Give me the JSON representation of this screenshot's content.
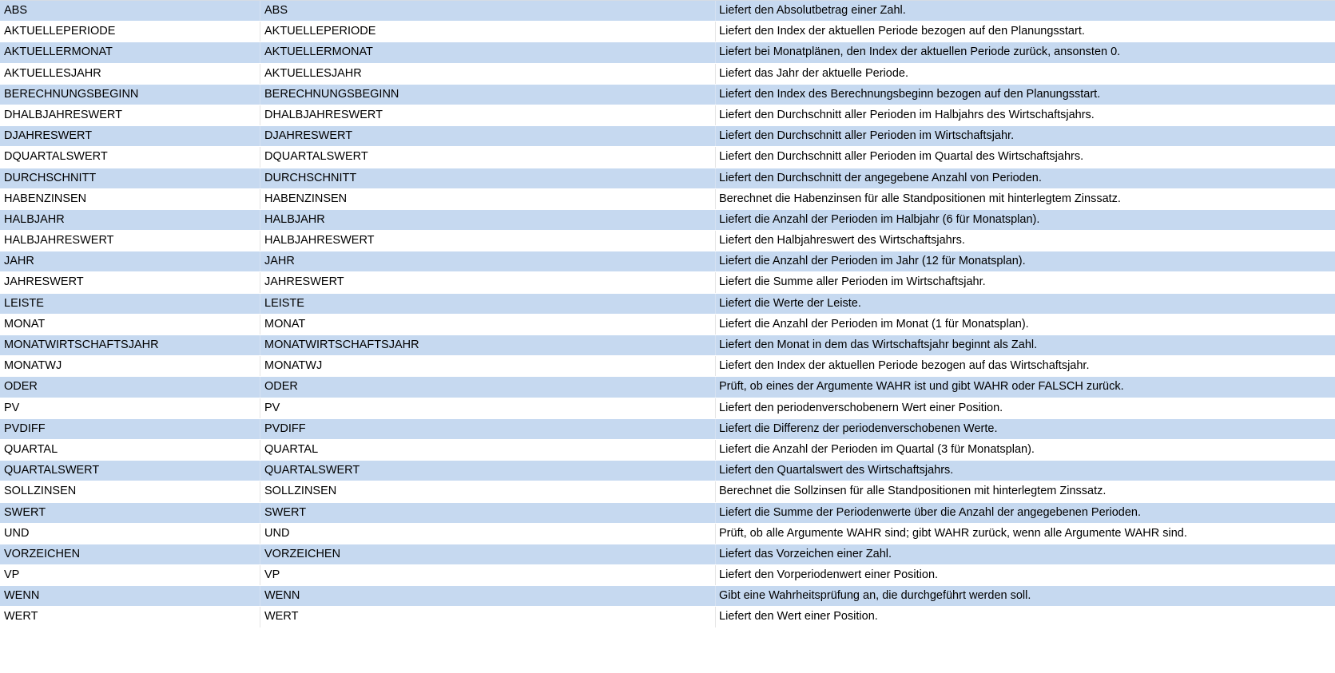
{
  "colors": {
    "band": "#c6d9f0",
    "plain": "#ffffff",
    "text": "#000000"
  },
  "rows": [
    {
      "name": "ABS",
      "code": "ABS",
      "description": "Liefert den Absolutbetrag einer Zahl."
    },
    {
      "name": "AKTUELLEPERIODE",
      "code": "AKTUELLEPERIODE",
      "description": "Liefert den Index der aktuellen Periode bezogen auf den Planungsstart."
    },
    {
      "name": "AKTUELLERMONAT",
      "code": "AKTUELLERMONAT",
      "description": "Liefert bei Monatplänen, den Index der aktuellen Periode zurück, ansonsten 0."
    },
    {
      "name": "AKTUELLESJAHR",
      "code": "AKTUELLESJAHR",
      "description": "Liefert das Jahr der aktuelle Periode."
    },
    {
      "name": "BERECHNUNGSBEGINN",
      "code": "BERECHNUNGSBEGINN",
      "description": "Liefert den Index des Berechnungsbeginn bezogen auf den Planungsstart."
    },
    {
      "name": "DHALBJAHRESWERT",
      "code": "DHALBJAHRESWERT",
      "description": "Liefert den Durchschnitt aller Perioden im Halbjahrs des Wirtschaftsjahrs."
    },
    {
      "name": "DJAHRESWERT",
      "code": "DJAHRESWERT",
      "description": "Liefert den Durchschnitt aller Perioden im Wirtschaftsjahr."
    },
    {
      "name": "DQUARTALSWERT",
      "code": "DQUARTALSWERT",
      "description": "Liefert den Durchschnitt aller Perioden im Quartal des Wirtschaftsjahrs."
    },
    {
      "name": "DURCHSCHNITT",
      "code": "DURCHSCHNITT",
      "description": "Liefert den Durchschnitt der angegebene Anzahl von Perioden."
    },
    {
      "name": "HABENZINSEN",
      "code": "HABENZINSEN",
      "description": "Berechnet die Habenzinsen für alle Standpositionen mit hinterlegtem Zinssatz."
    },
    {
      "name": "HALBJAHR",
      "code": "HALBJAHR",
      "description": "Liefert die Anzahl der Perioden im Halbjahr (6 für Monatsplan)."
    },
    {
      "name": "HALBJAHRESWERT",
      "code": "HALBJAHRESWERT",
      "description": "Liefert den Halbjahreswert des Wirtschaftsjahrs."
    },
    {
      "name": "JAHR",
      "code": "JAHR",
      "description": "Liefert die Anzahl der Perioden im Jahr (12 für Monatsplan)."
    },
    {
      "name": "JAHRESWERT",
      "code": "JAHRESWERT",
      "description": "Liefert die Summe aller Perioden im Wirtschaftsjahr."
    },
    {
      "name": "LEISTE",
      "code": "LEISTE",
      "description": "Liefert die Werte der Leiste."
    },
    {
      "name": "MONAT",
      "code": "MONAT",
      "description": "Liefert die Anzahl der Perioden im Monat (1 für Monatsplan)."
    },
    {
      "name": "MONATWIRTSCHAFTSJAHR",
      "code": "MONATWIRTSCHAFTSJAHR",
      "description": "Liefert den Monat in dem das Wirtschaftsjahr beginnt als Zahl."
    },
    {
      "name": "MONATWJ",
      "code": "MONATWJ",
      "description": "Liefert den Index der aktuellen Periode bezogen auf das Wirtschaftsjahr."
    },
    {
      "name": "ODER",
      "code": "ODER",
      "description": "Prüft, ob eines der Argumente WAHR ist und gibt WAHR oder FALSCH zurück."
    },
    {
      "name": "PV",
      "code": "PV",
      "description": "Liefert den periodenverschobenern Wert einer Position."
    },
    {
      "name": "PVDIFF",
      "code": "PVDIFF",
      "description": "Liefert die Differenz der periodenverschobenen Werte."
    },
    {
      "name": "QUARTAL",
      "code": "QUARTAL",
      "description": "Liefert die Anzahl der Perioden im Quartal (3 für Monatsplan)."
    },
    {
      "name": "QUARTALSWERT",
      "code": "QUARTALSWERT",
      "description": "Liefert den Quartalswert des Wirtschaftsjahrs."
    },
    {
      "name": "SOLLZINSEN",
      "code": "SOLLZINSEN",
      "description": "Berechnet die Sollzinsen für alle Standpositionen mit hinterlegtem Zinssatz."
    },
    {
      "name": "SWERT",
      "code": "SWERT",
      "description": "Liefert die Summe der Periodenwerte über die Anzahl der angegebenen Perioden."
    },
    {
      "name": "UND",
      "code": "UND",
      "description": "Prüft, ob alle Argumente WAHR sind; gibt WAHR zurück, wenn alle Argumente WAHR sind."
    },
    {
      "name": "VORZEICHEN",
      "code": "VORZEICHEN",
      "description": "Liefert das Vorzeichen einer Zahl."
    },
    {
      "name": "VP",
      "code": "VP",
      "description": "Liefert den Vorperiodenwert einer Position."
    },
    {
      "name": "WENN",
      "code": "WENN",
      "description": "Gibt eine Wahrheitsprüfung an, die durchgeführt werden soll."
    },
    {
      "name": "WERT",
      "code": "WERT",
      "description": "Liefert den Wert einer Position."
    }
  ]
}
